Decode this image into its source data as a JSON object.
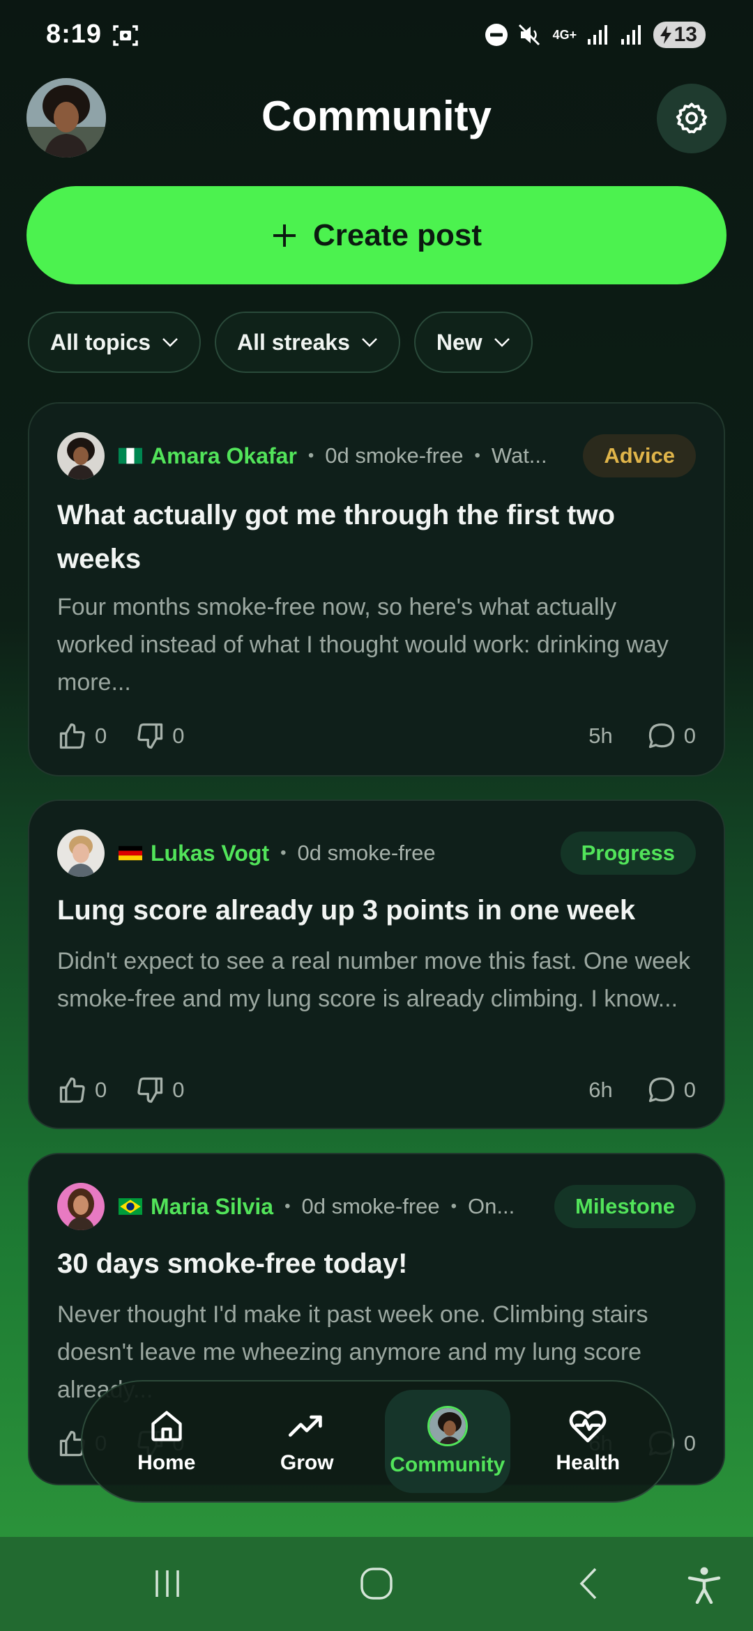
{
  "status_bar": {
    "time": "8:19",
    "network": "4G+",
    "battery": "13"
  },
  "header": {
    "title": "Community"
  },
  "create_post": {
    "label": "Create post"
  },
  "filters": [
    {
      "label": "All topics"
    },
    {
      "label": "All streaks"
    },
    {
      "label": "New"
    }
  ],
  "posts": [
    {
      "author": "Amara Okafar",
      "streak": "0d smoke-free",
      "extra": "Wat...",
      "tag": "Advice",
      "tag_color": "#e0b54a",
      "tag_bg": "#2b2a1c",
      "title": "What actually got me through the first two weeks",
      "excerpt": "Four months smoke-free now, so here's what actually worked instead of what I thought would work: drinking way more...",
      "likes": "0",
      "dislikes": "0",
      "time": "5h",
      "comments": "0"
    },
    {
      "author": "Lukas Vogt",
      "streak": "0d smoke-free",
      "tag": "Progress",
      "tag_color": "#52e45a",
      "tag_bg": "#143526",
      "title": "Lung score already up 3 points in one week",
      "excerpt": "Didn't expect to see a real number move this fast. One week smoke-free and my lung score is already climbing. I know...",
      "likes": "0",
      "dislikes": "0",
      "time": "6h",
      "comments": "0"
    },
    {
      "author": "Maria Silvia",
      "streak": "0d smoke-free",
      "extra": "On...",
      "tag": "Milestone",
      "tag_color": "#52e45a",
      "tag_bg": "#143526",
      "title": "30 days smoke-free today!",
      "excerpt": "Never thought I'd make it past week one. Climbing stairs doesn't leave me wheezing anymore and my lung score already...",
      "likes": "0",
      "dislikes": "0",
      "time": "6h",
      "comments": "0"
    }
  ],
  "bottom_nav": [
    {
      "label": "Home",
      "icon": "home-icon"
    },
    {
      "label": "Grow",
      "icon": "trending-up-icon"
    },
    {
      "label": "Community",
      "icon": "avatar",
      "active": true
    },
    {
      "label": "Health",
      "icon": "heart-pulse-icon"
    }
  ],
  "colors": {
    "accent": "#4cf24f",
    "author": "#52e45a"
  }
}
